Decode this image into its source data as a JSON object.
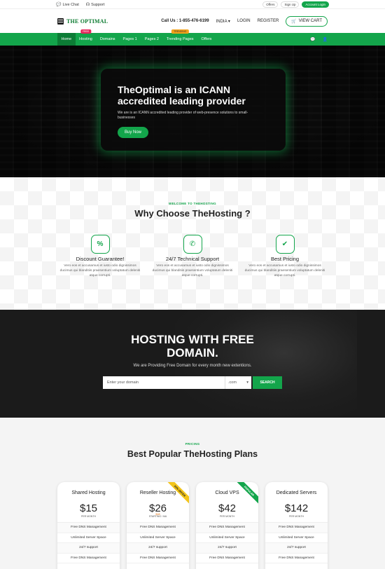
{
  "topbar": {
    "live_chat": "Live Chat",
    "support": "Support",
    "offers": "Offers",
    "sign_up": "Sign Up",
    "account_login": "Account Login"
  },
  "header": {
    "logo_text": "THE OPTIMAL",
    "call_label": "Call Us :",
    "call_number": "1-855-476-6199",
    "country": "INDIA",
    "login": "LOGIN",
    "register": "REGISTER",
    "view_cart": "VIEW CART"
  },
  "nav": {
    "items": [
      {
        "label": "Home",
        "badge": ""
      },
      {
        "label": "Hosting",
        "badge": "FREE"
      },
      {
        "label": "Domains",
        "badge": ""
      },
      {
        "label": "Pages 1",
        "badge": ""
      },
      {
        "label": "Pages 2",
        "badge": ""
      },
      {
        "label": "Trending Pages",
        "badge": "TRENDING"
      },
      {
        "label": "Offers",
        "badge": ""
      }
    ]
  },
  "hero": {
    "title": "TheOptimal is an ICANN accredited leading provider",
    "subtitle": "We are is an ICANN accredited leading provider of web-presence solutions to small-businesses",
    "cta": "Buy Now"
  },
  "why": {
    "kicker": "WELCOME TO THEHOSTING",
    "title": "Why Choose TheHosting ?",
    "features": [
      {
        "icon": "%",
        "title": "Discount Guarantee!",
        "desc": "Vero eos et accusamus et iusto odio dignissimos ducimus qui blanditiis praesentium voluptatum deleniti atque corrupti."
      },
      {
        "icon": "✆",
        "title": "24/7 Technical Support",
        "desc": "Vero eos et accusamus et iusto odio dignissimos ducimus qui blanditiis praesentium voluptatum deleniti atque corrupti."
      },
      {
        "icon": "✔",
        "title": "Best Pricing",
        "desc": "Vero eos et accusamus et iusto odio dignissimos ducimus qui blanditiis praesentium voluptatum deleniti atque corrupti."
      }
    ]
  },
  "domain": {
    "title": "HOSTING WITH FREE DOMAIN.",
    "subtitle": "We are Providing Free Domain for every month new extentions.",
    "input_placeholder": "Enter your domain",
    "tld": ".com",
    "search_btn": "SEARCH"
  },
  "pricing": {
    "kicker": "PRICING",
    "title": "Best Popular TheHosting Plans",
    "plans": [
      {
        "name": "Shared Hosting",
        "price": "$15",
        "period": "PER MONTH",
        "ribbon": "",
        "old": "",
        "features": [
          "Free DNS Management",
          "Unlimited Server Space",
          "24/7 support",
          "Free DNS Management"
        ]
      },
      {
        "name": "Reseller Hosting",
        "price": "$26",
        "period": "STARTING / MA",
        "ribbon": "50% OFFER",
        "old": "$48",
        "features": [
          "Free DNS Management",
          "Unlimited Server Space",
          "24/7 support",
          "Free DNS Management"
        ]
      },
      {
        "name": "Cloud VPS",
        "price": "$42",
        "period": "PER MONTH",
        "ribbon": "POPULAR",
        "old": "",
        "features": [
          "Free DNS Management",
          "Unlimited Server Space",
          "24/7 support",
          "Free DNS Management"
        ]
      },
      {
        "name": "Dedicated Servers",
        "price": "$142",
        "period": "PER MONTH",
        "ribbon": "",
        "old": "",
        "features": [
          "Free DNS Management",
          "Unlimited Server Space",
          "24/7 support",
          "Free DNS Management"
        ]
      }
    ]
  },
  "colors": {
    "brand_green": "#13a54b",
    "dark": "#1b1b1b",
    "badge_red": "#e6245a",
    "badge_orange": "#f3a21a"
  }
}
